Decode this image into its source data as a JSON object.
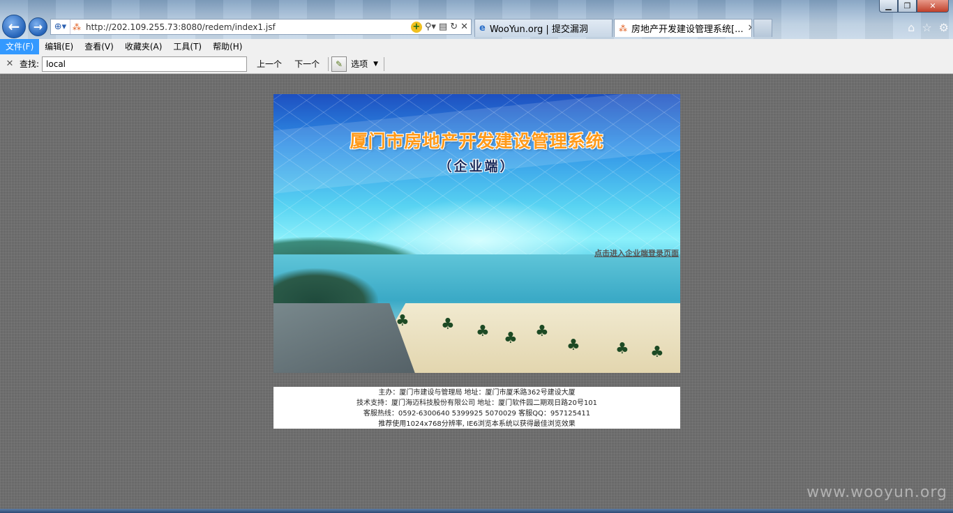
{
  "browser": {
    "url": "http://202.109.255.73:8080/redem/index1.jsf",
    "tabs": [
      {
        "label": "WooYun.org | 提交漏洞",
        "active": false
      },
      {
        "label": "房地产开发建设管理系统[...",
        "active": true
      }
    ],
    "window_controls": {
      "minimize": "▁",
      "maximize": "❐",
      "close": "✕"
    }
  },
  "menu": {
    "items": [
      "文件(F)",
      "编辑(E)",
      "查看(V)",
      "收藏夹(A)",
      "工具(T)",
      "帮助(H)"
    ]
  },
  "findbar": {
    "label": "查找:",
    "value": "local",
    "prev": "上一个",
    "next": "下一个",
    "options": "选项"
  },
  "banner": {
    "title": "厦门市房地产开发建设管理系统",
    "subtitle": "（企业端）",
    "login_link": "点击进入企业端登录页面"
  },
  "footer": {
    "line1": "主办：厦门市建设与管理局   地址：厦门市厦禾路362号建设大厦",
    "line2": "技术支持：厦门海迈科技股份有限公司   地址：厦门软件园二期观日路20号101",
    "line3": "客服热线：0592-6300640 5399925 5070029   客服QQ：957125411",
    "line4": "推荐使用1024x768分辨率, IE6浏览本系统以获得最佳浏览效果"
  },
  "watermark": "www.wooyun.org",
  "colors": {
    "accent": "#3399ff",
    "title_orange": "#ff9a1a",
    "page_bg": "#6a6a6a"
  }
}
